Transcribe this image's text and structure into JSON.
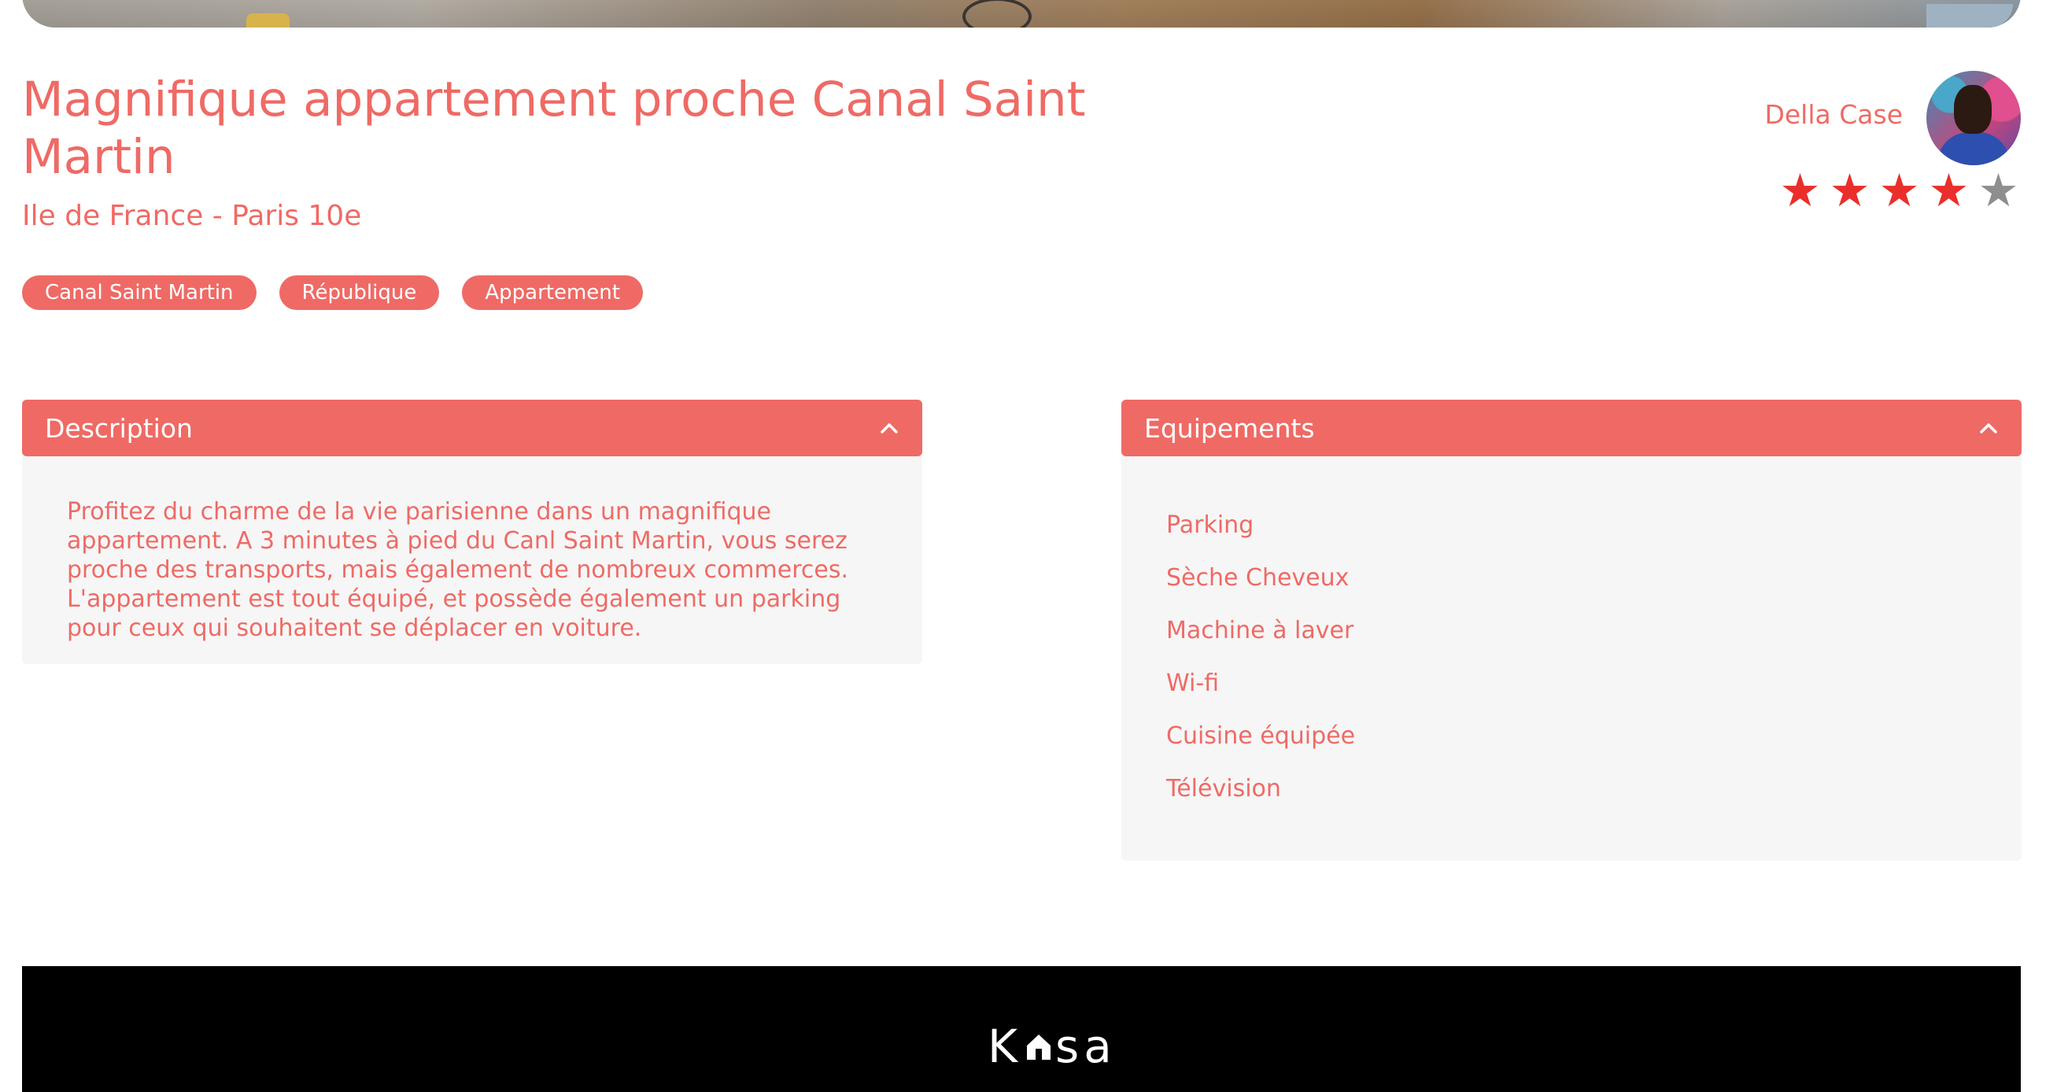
{
  "listing": {
    "title": "Magnifique appartement proche Canal Saint Martin",
    "location": "Ile de France - Paris 10e",
    "tags": [
      "Canal Saint Martin",
      "République",
      "Appartement"
    ]
  },
  "host": {
    "name": "Della Case",
    "rating": 4,
    "rating_max": 5
  },
  "description": {
    "title": "Description",
    "text": "Profitez du charme de la vie parisienne dans un magnifique appartement. A 3 minutes à pied du Canl Saint Martin, vous serez proche des transports, mais également de nombreux commerces. L'appartement est tout équipé, et possède également un parking pour ceux qui souhaitent se déplacer en voiture."
  },
  "equipments": {
    "title": "Equipements",
    "items": [
      "Parking",
      "Sèche Cheveux",
      "Machine à laver",
      "Wi-fi",
      "Cuisine équipée",
      "Télévision"
    ]
  },
  "footer": {
    "logo_left": "K",
    "logo_right": "sa"
  },
  "colors": {
    "accent": "#ef6a65",
    "star_on": "#ea2e2b",
    "star_off": "#8e8e8e",
    "panel_bg": "#f6f6f6",
    "footer_bg": "#000000"
  }
}
